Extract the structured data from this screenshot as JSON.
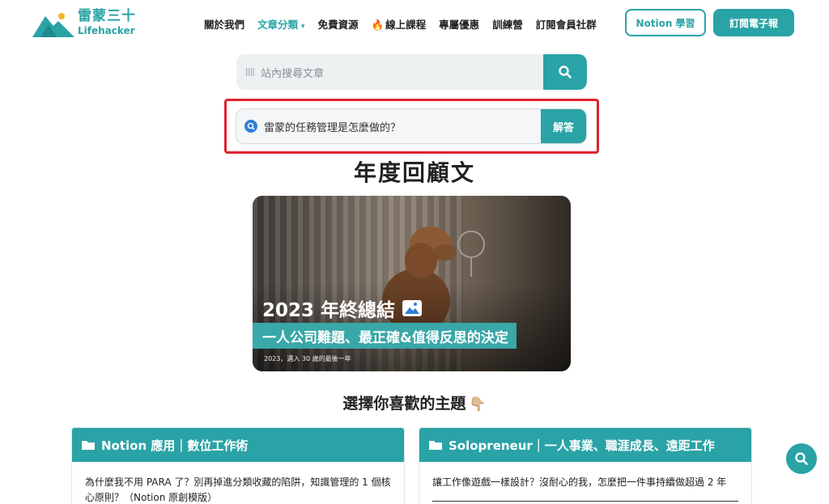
{
  "brand": {
    "name_cn": "雷蒙三十",
    "name_en": "Lifehacker",
    "color": "#2aa3a6"
  },
  "nav": {
    "about": "關於我們",
    "categories": "文章分類",
    "free": "免費資源",
    "courses": "線上課程",
    "deals": "專屬優惠",
    "camp": "訓練營",
    "community": "訂閱會員社群",
    "notion_btn": "Notion 學習",
    "newsletter_btn": "訂閱電子報"
  },
  "search": {
    "placeholder": "站內搜尋文章"
  },
  "ask": {
    "question": "雷蒙的任務管理是怎麼做的？",
    "button": "解答",
    "highlight_color": "#e0212e"
  },
  "annual": {
    "heading": "年度回顧文",
    "card_title": "2023 年終總結",
    "card_banner": "一人公司難題、最正確&值得反思的決定",
    "card_caption": "2023，邁入 30 歲的最後一年"
  },
  "topics": {
    "heading": "選擇你喜歡的主題",
    "emoji": "👇🏼",
    "cards": [
      {
        "title": "Notion 應用｜數位工作術",
        "article": "為什麼我不用 PARA 了？別再掉進分類收藏的陷阱，知識管理的 1 個核心原則？（Notion 原創模版）"
      },
      {
        "title": "Solopreneur｜一人事業、職涯成長、遠距工作",
        "article": "讓工作像遊戲一樣設計？沒耐心的我，怎麼把一件事持續做超過 2 年"
      }
    ]
  }
}
